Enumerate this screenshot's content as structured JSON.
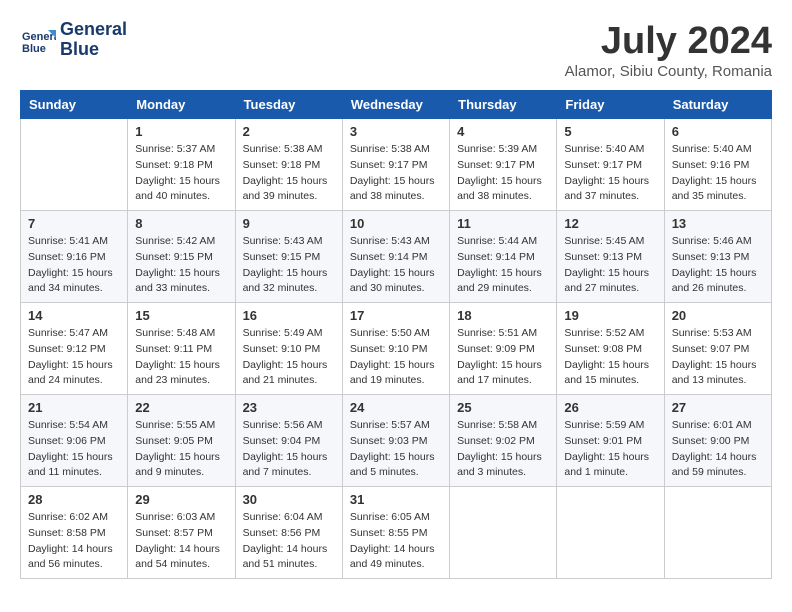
{
  "header": {
    "logo_line1": "General",
    "logo_line2": "Blue",
    "month_title": "July 2024",
    "location": "Alamor, Sibiu County, Romania"
  },
  "days_of_week": [
    "Sunday",
    "Monday",
    "Tuesday",
    "Wednesday",
    "Thursday",
    "Friday",
    "Saturday"
  ],
  "weeks": [
    [
      {
        "day": "",
        "info": ""
      },
      {
        "day": "1",
        "info": "Sunrise: 5:37 AM\nSunset: 9:18 PM\nDaylight: 15 hours\nand 40 minutes."
      },
      {
        "day": "2",
        "info": "Sunrise: 5:38 AM\nSunset: 9:18 PM\nDaylight: 15 hours\nand 39 minutes."
      },
      {
        "day": "3",
        "info": "Sunrise: 5:38 AM\nSunset: 9:17 PM\nDaylight: 15 hours\nand 38 minutes."
      },
      {
        "day": "4",
        "info": "Sunrise: 5:39 AM\nSunset: 9:17 PM\nDaylight: 15 hours\nand 38 minutes."
      },
      {
        "day": "5",
        "info": "Sunrise: 5:40 AM\nSunset: 9:17 PM\nDaylight: 15 hours\nand 37 minutes."
      },
      {
        "day": "6",
        "info": "Sunrise: 5:40 AM\nSunset: 9:16 PM\nDaylight: 15 hours\nand 35 minutes."
      }
    ],
    [
      {
        "day": "7",
        "info": "Sunrise: 5:41 AM\nSunset: 9:16 PM\nDaylight: 15 hours\nand 34 minutes."
      },
      {
        "day": "8",
        "info": "Sunrise: 5:42 AM\nSunset: 9:15 PM\nDaylight: 15 hours\nand 33 minutes."
      },
      {
        "day": "9",
        "info": "Sunrise: 5:43 AM\nSunset: 9:15 PM\nDaylight: 15 hours\nand 32 minutes."
      },
      {
        "day": "10",
        "info": "Sunrise: 5:43 AM\nSunset: 9:14 PM\nDaylight: 15 hours\nand 30 minutes."
      },
      {
        "day": "11",
        "info": "Sunrise: 5:44 AM\nSunset: 9:14 PM\nDaylight: 15 hours\nand 29 minutes."
      },
      {
        "day": "12",
        "info": "Sunrise: 5:45 AM\nSunset: 9:13 PM\nDaylight: 15 hours\nand 27 minutes."
      },
      {
        "day": "13",
        "info": "Sunrise: 5:46 AM\nSunset: 9:13 PM\nDaylight: 15 hours\nand 26 minutes."
      }
    ],
    [
      {
        "day": "14",
        "info": "Sunrise: 5:47 AM\nSunset: 9:12 PM\nDaylight: 15 hours\nand 24 minutes."
      },
      {
        "day": "15",
        "info": "Sunrise: 5:48 AM\nSunset: 9:11 PM\nDaylight: 15 hours\nand 23 minutes."
      },
      {
        "day": "16",
        "info": "Sunrise: 5:49 AM\nSunset: 9:10 PM\nDaylight: 15 hours\nand 21 minutes."
      },
      {
        "day": "17",
        "info": "Sunrise: 5:50 AM\nSunset: 9:10 PM\nDaylight: 15 hours\nand 19 minutes."
      },
      {
        "day": "18",
        "info": "Sunrise: 5:51 AM\nSunset: 9:09 PM\nDaylight: 15 hours\nand 17 minutes."
      },
      {
        "day": "19",
        "info": "Sunrise: 5:52 AM\nSunset: 9:08 PM\nDaylight: 15 hours\nand 15 minutes."
      },
      {
        "day": "20",
        "info": "Sunrise: 5:53 AM\nSunset: 9:07 PM\nDaylight: 15 hours\nand 13 minutes."
      }
    ],
    [
      {
        "day": "21",
        "info": "Sunrise: 5:54 AM\nSunset: 9:06 PM\nDaylight: 15 hours\nand 11 minutes."
      },
      {
        "day": "22",
        "info": "Sunrise: 5:55 AM\nSunset: 9:05 PM\nDaylight: 15 hours\nand 9 minutes."
      },
      {
        "day": "23",
        "info": "Sunrise: 5:56 AM\nSunset: 9:04 PM\nDaylight: 15 hours\nand 7 minutes."
      },
      {
        "day": "24",
        "info": "Sunrise: 5:57 AM\nSunset: 9:03 PM\nDaylight: 15 hours\nand 5 minutes."
      },
      {
        "day": "25",
        "info": "Sunrise: 5:58 AM\nSunset: 9:02 PM\nDaylight: 15 hours\nand 3 minutes."
      },
      {
        "day": "26",
        "info": "Sunrise: 5:59 AM\nSunset: 9:01 PM\nDaylight: 15 hours\nand 1 minute."
      },
      {
        "day": "27",
        "info": "Sunrise: 6:01 AM\nSunset: 9:00 PM\nDaylight: 14 hours\nand 59 minutes."
      }
    ],
    [
      {
        "day": "28",
        "info": "Sunrise: 6:02 AM\nSunset: 8:58 PM\nDaylight: 14 hours\nand 56 minutes."
      },
      {
        "day": "29",
        "info": "Sunrise: 6:03 AM\nSunset: 8:57 PM\nDaylight: 14 hours\nand 54 minutes."
      },
      {
        "day": "30",
        "info": "Sunrise: 6:04 AM\nSunset: 8:56 PM\nDaylight: 14 hours\nand 51 minutes."
      },
      {
        "day": "31",
        "info": "Sunrise: 6:05 AM\nSunset: 8:55 PM\nDaylight: 14 hours\nand 49 minutes."
      },
      {
        "day": "",
        "info": ""
      },
      {
        "day": "",
        "info": ""
      },
      {
        "day": "",
        "info": ""
      }
    ]
  ]
}
